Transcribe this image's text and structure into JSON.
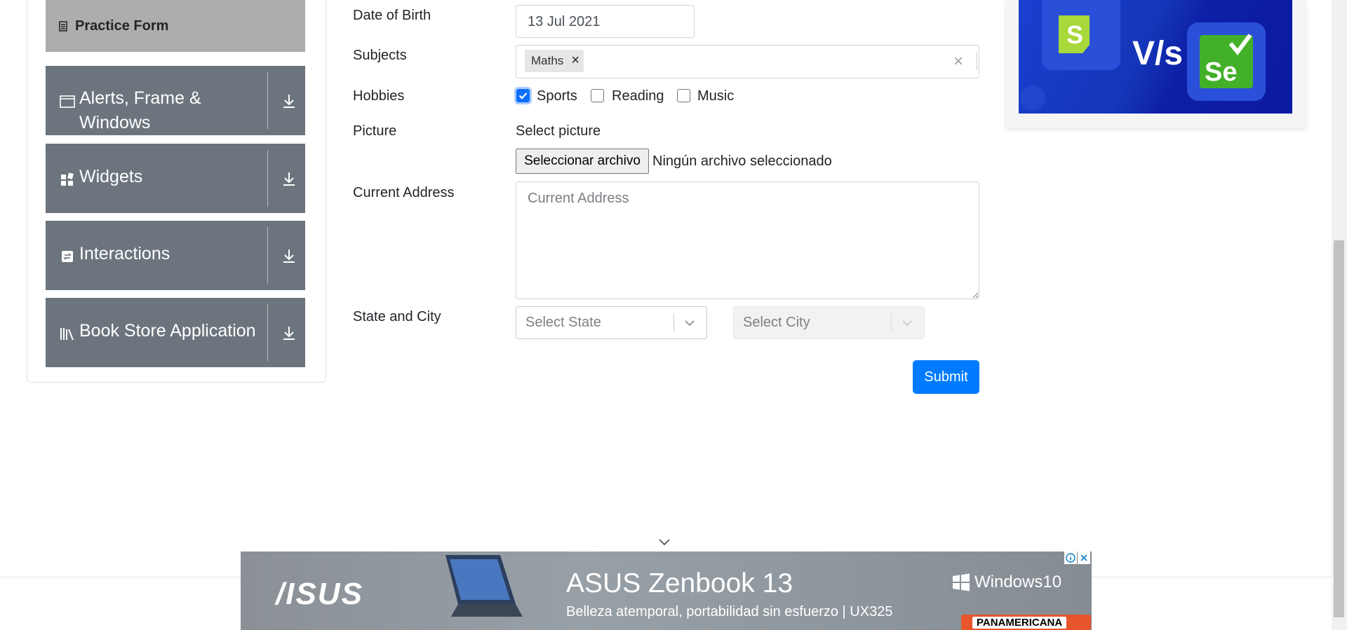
{
  "sidebar": {
    "practice_form": "Practice Form",
    "items": [
      {
        "label": "Alerts, Frame & Windows"
      },
      {
        "label": "Widgets"
      },
      {
        "label": "Interactions"
      },
      {
        "label": "Book Store Application"
      }
    ]
  },
  "form": {
    "dob_label": "Date of Birth",
    "dob_value": "13 Jul 2021",
    "subjects_label": "Subjects",
    "subjects": [
      "Maths"
    ],
    "chip_remove": "×",
    "clear_all": "×",
    "hobbies_label": "Hobbies",
    "hobbies": [
      {
        "label": "Sports",
        "checked": true
      },
      {
        "label": "Reading",
        "checked": false
      },
      {
        "label": "Music",
        "checked": false
      }
    ],
    "picture_label": "Picture",
    "select_picture": "Select picture",
    "file_button": "Seleccionar archivo",
    "file_status": "Ningún archivo seleccionado",
    "address_label": "Current Address",
    "address_placeholder": "Current Address",
    "state_city_label": "State and City",
    "state_placeholder": "Select State",
    "city_placeholder": "Select City",
    "submit": "Submit"
  },
  "bottom_ad": {
    "brand": "/ISUS",
    "headline": "ASUS Zenbook 13",
    "subline": "Belleza atemporal, portabilidad sin esfuerzo  | UX325",
    "os": "Windows10",
    "retailer": "PANAMERICANA"
  },
  "colors": {
    "primary": "#007bff",
    "sidebar_item": "#6c757d",
    "practice_item": "#adadad"
  }
}
